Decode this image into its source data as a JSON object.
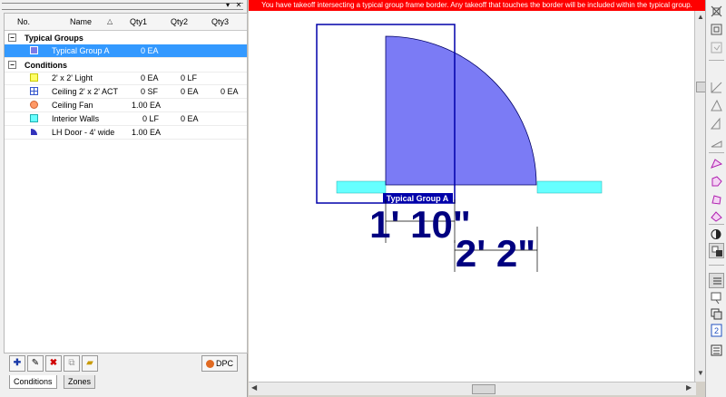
{
  "grid": {
    "columns": [
      "No.",
      "Name",
      "Qty1",
      "Qty2",
      "Qty3"
    ],
    "sections": [
      {
        "title": "Typical Groups",
        "toggle": "−"
      },
      {
        "title": "Conditions",
        "toggle": "−"
      }
    ],
    "typical_groups": [
      {
        "name": "Typical Group A",
        "qty1": "0 EA",
        "qty2": "",
        "qty3": "",
        "swatch": "#7a7ae8"
      }
    ],
    "conditions": [
      {
        "name": "2' x 2' Light",
        "qty1": "0 EA",
        "qty2": "0 LF",
        "qty3": "",
        "swatch": "#ffff66"
      },
      {
        "name": "Ceiling 2' x 2' ACT",
        "qty1": "0 SF",
        "qty2": "0 EA",
        "qty3": "0 EA",
        "swatch": "#3355cc"
      },
      {
        "name": "Ceiling Fan",
        "qty1": "1.00 EA",
        "qty2": "",
        "qty3": "",
        "swatch": "#ff9966"
      },
      {
        "name": "Interior  Walls",
        "qty1": "0 LF",
        "qty2": "0 EA",
        "qty3": "",
        "swatch": "#66ffff"
      },
      {
        "name": "LH Door - 4' wide",
        "qty1": "1.00 EA",
        "qty2": "",
        "qty3": "",
        "swatch": "#3333bb"
      }
    ]
  },
  "toolbar": {
    "add_icon": "plus-icon",
    "edit_icon": "pencil-icon",
    "delete_icon": "red-x-icon",
    "copy_icon": "copy-icon",
    "folder_icon": "folder-icon",
    "dpc_label": "DPC"
  },
  "tabs": [
    "Conditions",
    "Zones"
  ],
  "canvas": {
    "warning": "You have takeoff intersecting a typical group frame border.  Any takeoff that touches the border will be included within the typical group.",
    "group_label": "Typical Group A",
    "dim_1": "1' 10\"",
    "dim_2": "2' 2\"",
    "door_color": "#7b7bf5",
    "wall_color": "#66ffff",
    "frame_color": "#0000aa",
    "dim_color": "#000080"
  },
  "right_toolbar_icons": [
    "zoom-extents-icon",
    "zoom-window-icon",
    "pan-icon",
    "dimension-1-icon",
    "dimension-2-icon",
    "dimension-3-icon",
    "dimension-4-icon",
    "takeoff-1-icon",
    "takeoff-2-icon",
    "takeoff-3-icon",
    "takeoff-4-icon",
    "contrast-icon",
    "overlay-icon",
    "list-icon",
    "annotate-icon",
    "layers-icon",
    "page-number-icon",
    "report-icon"
  ]
}
